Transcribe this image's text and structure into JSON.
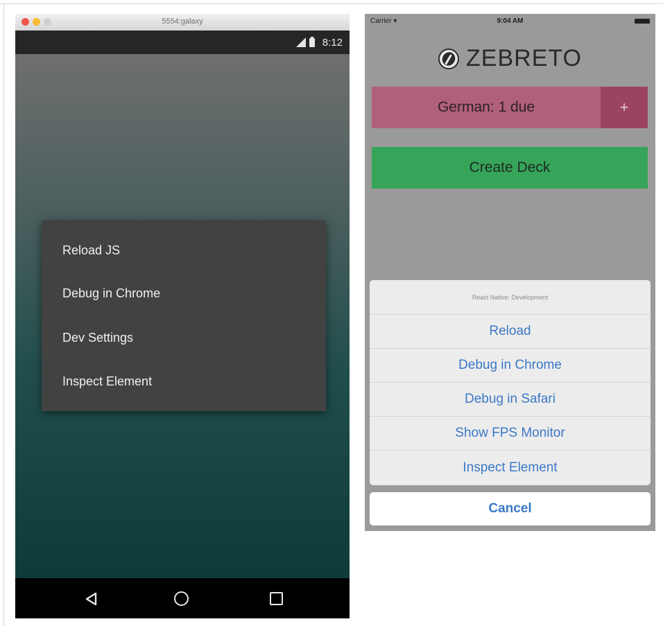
{
  "android": {
    "window_title": "5554:galaxy",
    "status_time": "8:12",
    "dev_menu": {
      "items": [
        "Reload JS",
        "Debug in Chrome",
        "Dev Settings",
        "Inspect Element"
      ]
    },
    "nav_icons": [
      "back-icon",
      "home-icon",
      "recent-apps-icon"
    ]
  },
  "ios": {
    "carrier": "Carrier ▾",
    "time": "9:04 AM",
    "app_name": "ZEBRETO",
    "deck_label": "German: 1 due",
    "add_label": "+",
    "create_deck_label": "Create Deck",
    "action_sheet": {
      "title": "React Native: Development",
      "buttons": [
        "Reload",
        "Debug in Chrome",
        "Debug in Safari",
        "Show FPS Monitor",
        "Inspect Element"
      ],
      "cancel": "Cancel"
    },
    "colors": {
      "deck": "#b0607a",
      "deck_add": "#9a4461",
      "create": "#36a459",
      "action_text": "#3b78c7"
    }
  }
}
